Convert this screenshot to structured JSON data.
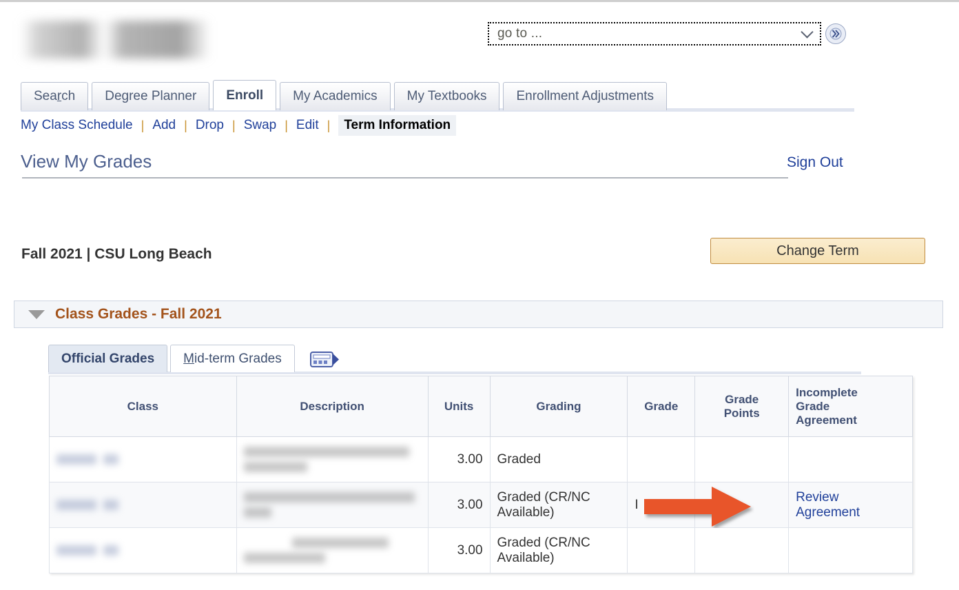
{
  "header": {
    "user_name_redacted": "",
    "goto": {
      "value": "go to ...",
      "chevron_icon": "chevron-down-icon",
      "go_button_icon": "double-chevron-right-icon"
    }
  },
  "main_tabs": [
    {
      "label": "Search",
      "accesskey": "r",
      "active": false
    },
    {
      "label": "Degree Planner",
      "active": false
    },
    {
      "label": "Enroll",
      "active": true
    },
    {
      "label": "My Academics",
      "active": false
    },
    {
      "label": "My Textbooks",
      "active": false
    },
    {
      "label": "Enrollment Adjustments",
      "active": false
    }
  ],
  "sub_nav": {
    "items": [
      {
        "label": "My Class Schedule",
        "active": false
      },
      {
        "label": "Add",
        "active": false
      },
      {
        "label": "Drop",
        "active": false
      },
      {
        "label": "Swap",
        "active": false
      },
      {
        "label": "Edit",
        "active": false
      },
      {
        "label": "Term Information",
        "active": true
      }
    ],
    "separator": "|"
  },
  "page": {
    "title": "View My Grades",
    "sign_out": "Sign Out",
    "term_line": "Fall 2021 | CSU Long Beach",
    "change_term_button": "Change Term"
  },
  "group_box": {
    "title": "Class Grades - Fall 2021",
    "collapse_icon": "triangle-down-icon"
  },
  "inner_tabs": [
    {
      "label": "Official Grades",
      "active": true
    },
    {
      "label": "Mid-term Grades",
      "accesskey": "M",
      "active": false
    }
  ],
  "grid_icon": "view-grid-icon",
  "grades_table": {
    "columns": [
      "Class",
      "Description",
      "Units",
      "Grading",
      "Grade",
      "Grade Points",
      "Incomplete Grade Agreement"
    ],
    "column_header_2_line1": "Grade",
    "column_header_2_line2": "Points",
    "column_header_3_line1": "Incomplete",
    "column_header_3_line2": "Grade",
    "column_header_3_line3": "Agreement",
    "rows": [
      {
        "class": "",
        "description": "",
        "units": "3.00",
        "grading": "Graded",
        "grade": "",
        "grade_points": "",
        "incomplete_grade_agreement": "",
        "redacted": true
      },
      {
        "class": "",
        "description": "",
        "units": "3.00",
        "grading": "Graded (CR/NC Available)",
        "grade": "I",
        "grade_points": "",
        "incomplete_grade_agreement": "Review Agreement",
        "redacted": true
      },
      {
        "class": "",
        "description": "",
        "units": "3.00",
        "grading": "Graded (CR/NC Available)",
        "grade": "",
        "grade_points": "",
        "incomplete_grade_agreement": "",
        "redacted": true
      }
    ]
  },
  "annotation": {
    "arrow_color": "#e8542b",
    "arrow_direction": "right",
    "points_to": "Review Agreement"
  },
  "colors": {
    "link": "#20409a",
    "group_title": "#a3531b",
    "header_text": "#415073",
    "change_term_border": "#c08b3e",
    "arrow": "#e8542b"
  }
}
